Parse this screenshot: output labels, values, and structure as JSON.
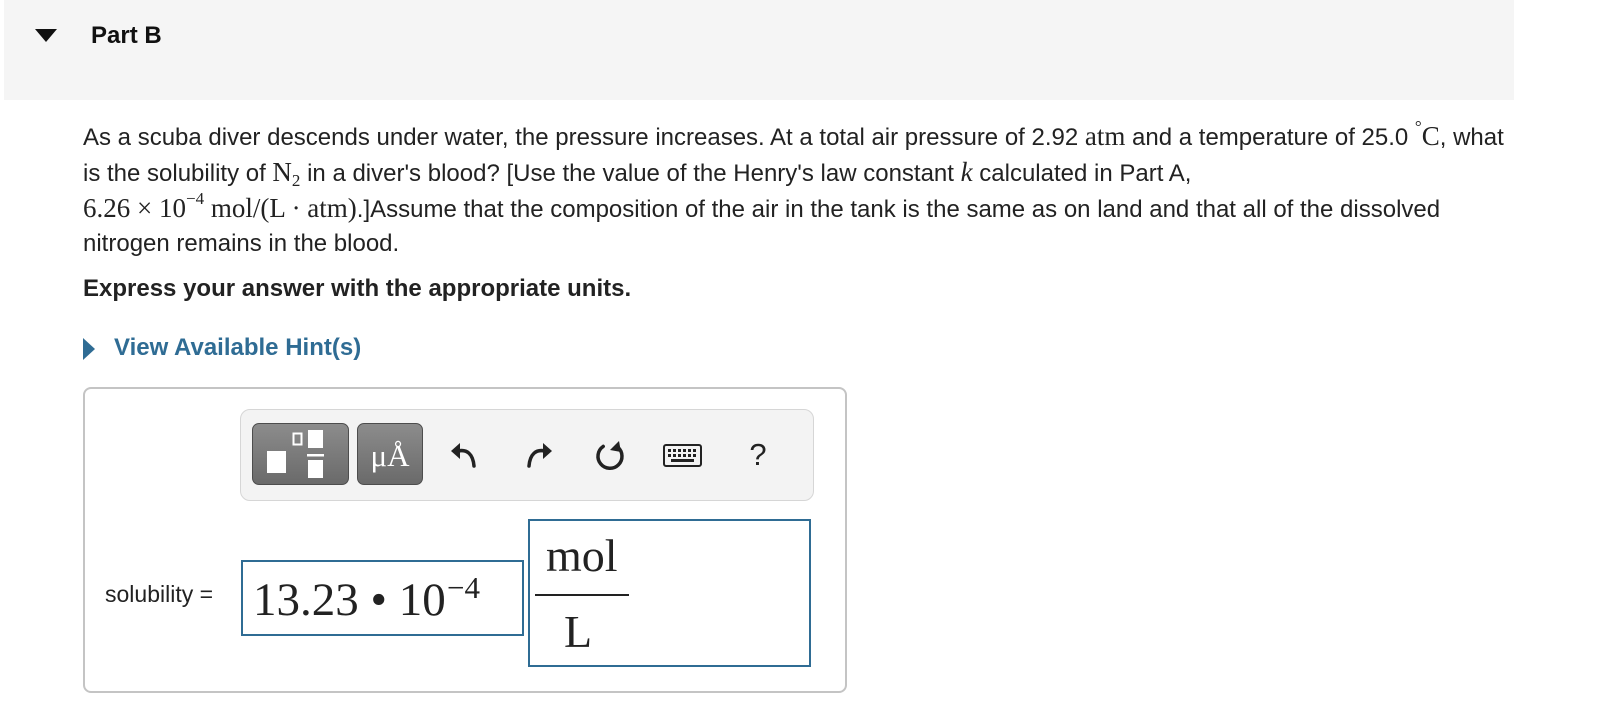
{
  "part": {
    "title": "Part B"
  },
  "question": {
    "t1": "As a scuba diver descends under water, the pressure increases. At a total air pressure of 2.92 ",
    "unit_atm": "atm",
    "t2": " and a temperature of 25.0 ",
    "deg": "°",
    "c": "C",
    "t3": ", what is the solubility of ",
    "n": "N",
    "n_sub": "2",
    "t4": " in a diver's blood? [Use the value of the Henry's law constant ",
    "k": "k",
    "t5": " calculated in Part A,",
    "k_mantissa": "6.26",
    "times": " × ",
    "k_base": "10",
    "k_exp": "−4",
    "k_unit": " mol/(L · atm)",
    "t6": ".]Assume that the composition of the air in the tank is the same as on land and that all of the dissolved nitrogen remains in the blood."
  },
  "instruction": "Express your answer with the appropriate units.",
  "hint": {
    "label": "View Available Hint(s)"
  },
  "toolbar": {
    "units_button_label": "μÅ",
    "icons": [
      "templates-icon",
      "undo-icon",
      "redo-icon",
      "reset-icon",
      "keyboard-icon",
      "help-icon"
    ],
    "help_label": "?"
  },
  "answer": {
    "variable_label": "solubility =",
    "value": "13.23 • 10",
    "exponent": "−4",
    "unit_numerator": "mol",
    "unit_denominator": "L"
  },
  "colors": {
    "accent": "#2f6c94",
    "header_bg": "#f5f5f5",
    "button_gray": "#7a7a7a"
  }
}
